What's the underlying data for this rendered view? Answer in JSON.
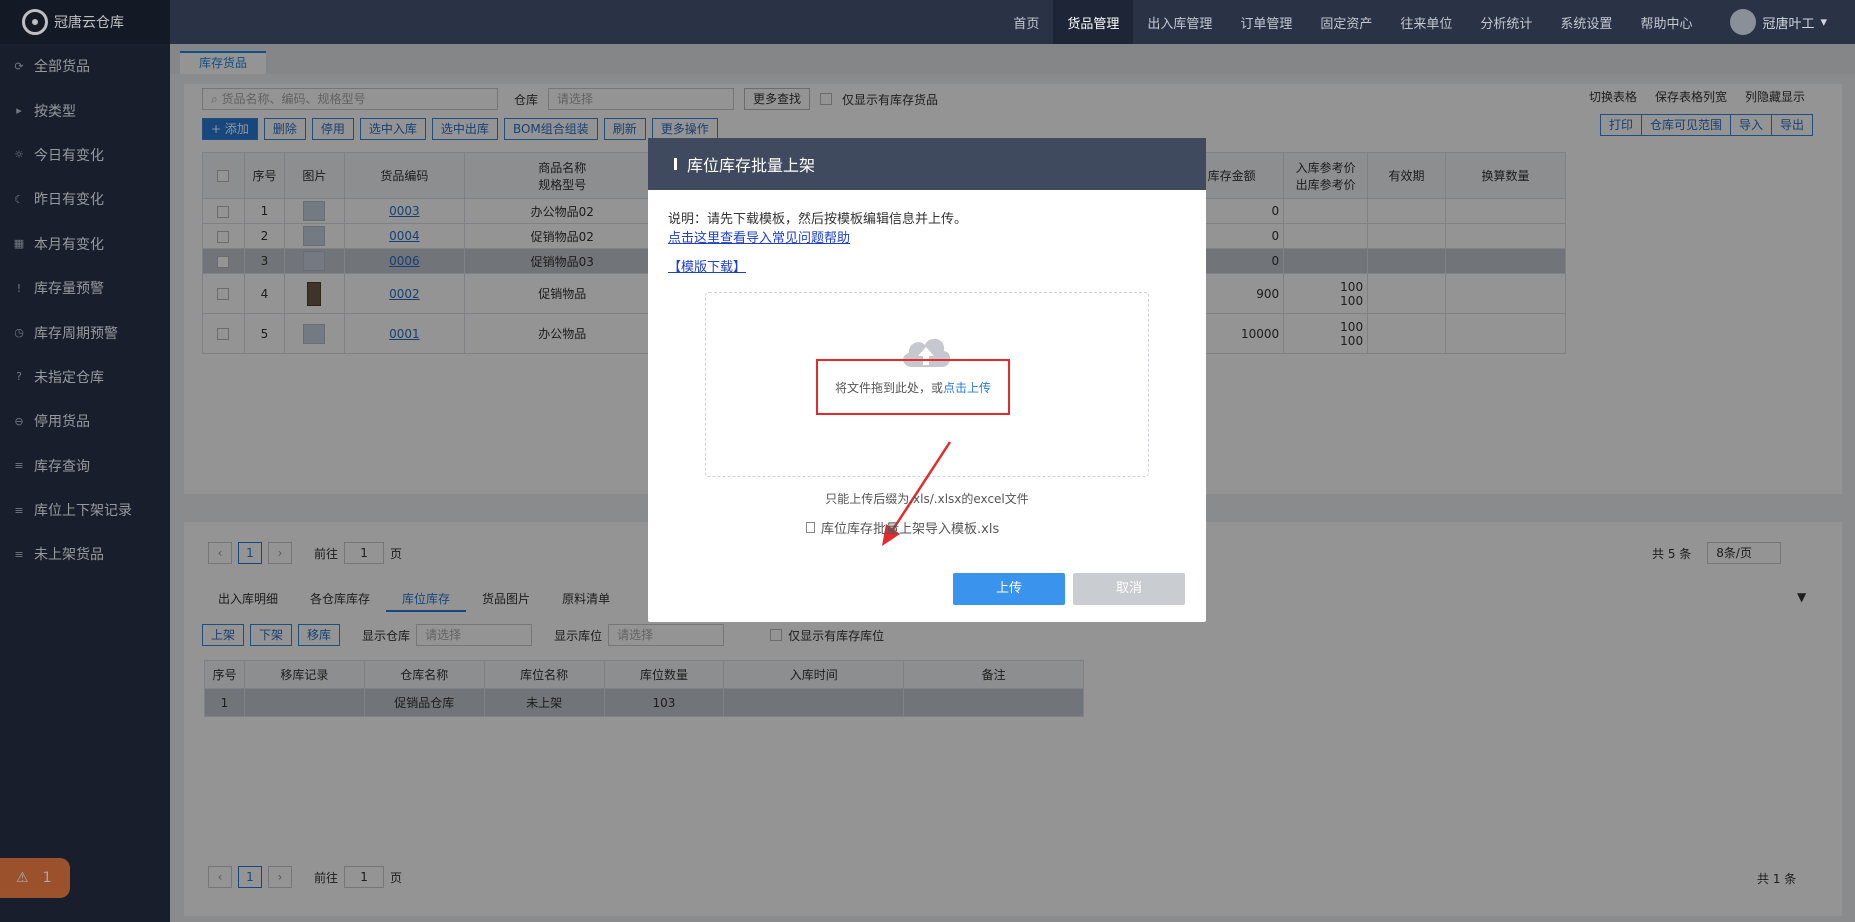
{
  "app": {
    "title": "冠唐云仓库"
  },
  "sidebar": {
    "items": [
      {
        "label": "全部货品",
        "icon": "refresh-icon"
      },
      {
        "label": "按类型",
        "icon": "caret-right-icon"
      },
      {
        "label": "今日有变化",
        "icon": "sun-icon"
      },
      {
        "label": "昨日有变化",
        "icon": "moon-icon"
      },
      {
        "label": "本月有变化",
        "icon": "calendar-icon"
      },
      {
        "label": "库存量预警",
        "icon": "alert-icon"
      },
      {
        "label": "库存周期预警",
        "icon": "clock-icon"
      },
      {
        "label": "未指定仓库",
        "icon": "question-icon"
      },
      {
        "label": "停用货品",
        "icon": "minus-circle-icon"
      },
      {
        "label": "库存查询",
        "icon": "list-icon"
      },
      {
        "label": "库位上下架记录",
        "icon": "list-icon"
      },
      {
        "label": "未上架货品",
        "icon": "list-icon"
      }
    ],
    "alarm_count": "1"
  },
  "topnav": {
    "items": [
      "首页",
      "货品管理",
      "出入库管理",
      "订单管理",
      "固定资产",
      "往来单位",
      "分析统计",
      "系统设置",
      "帮助中心"
    ],
    "active": "货品管理",
    "user": "冠唐叶工"
  },
  "page_tab": "库存货品",
  "search": {
    "placeholder": "货品名称、编码、规格型号",
    "warehouse_label": "仓库",
    "warehouse_placeholder": "请选择",
    "more_search": "更多查找",
    "only_stock": "仅显示有库存货品"
  },
  "toolbar": {
    "add": "+ 添加",
    "delete": "删除",
    "disable": "停用",
    "in": "选中入库",
    "out": "选中出库",
    "bom": "BOM组合组装",
    "refresh": "刷新",
    "more": "更多操作"
  },
  "right_tools": {
    "switch": "切换表格",
    "save_width": "保存表格列宽",
    "hide_cols": "列隐藏显示",
    "print": "打印",
    "visible": "仓库可见范围",
    "import": "导入",
    "export": "导出"
  },
  "table": {
    "headers": [
      "序号",
      "图片",
      "货品编码",
      "商品名称",
      "规格型号",
      "库存金额",
      "入库参考价",
      "出库参考价",
      "有效期",
      "换算数量"
    ],
    "rows": [
      {
        "no": "1",
        "code": "0003",
        "name": "办公物品02",
        "amount": "0",
        "inp": "",
        "outp": ""
      },
      {
        "no": "2",
        "code": "0004",
        "name": "促销物品02",
        "amount": "0",
        "inp": "",
        "outp": ""
      },
      {
        "no": "3",
        "code": "0006",
        "name": "促销物品03",
        "amount": "0",
        "inp": "",
        "outp": ""
      },
      {
        "no": "4",
        "code": "0002",
        "name": "促销物品",
        "amount": "900",
        "inp": "100",
        "outp": "100"
      },
      {
        "no": "5",
        "code": "0001",
        "name": "办公物品",
        "amount": "10000",
        "inp": "100",
        "outp": "100"
      }
    ]
  },
  "pager": {
    "current": "1",
    "goto": "前往",
    "page_unit": "页",
    "total": "共 5 条",
    "per_page": "8条/页"
  },
  "subtabs": [
    "出入库明细",
    "各仓库库存",
    "库位库存",
    "货品图片",
    "原料清单"
  ],
  "subtab_active": "库位库存",
  "sub_toolbar": {
    "up": "上架",
    "down": "下架",
    "move": "移库",
    "show_wh": "显示仓库",
    "show_loc": "显示库位",
    "placeholder": "请选择",
    "only_loc": "仅显示有库存库位"
  },
  "sub_table": {
    "headers": [
      "序号",
      "移库记录",
      "仓库名称",
      "库位名称",
      "库位数量",
      "入库时间",
      "备注"
    ],
    "rows": [
      {
        "no": "1",
        "record": "",
        "wh": "促销品仓库",
        "loc": "未上架",
        "qty": "103",
        "time": "",
        "note": ""
      }
    ]
  },
  "sub_pager": {
    "current": "1",
    "goto": "前往",
    "page_unit": "页",
    "total": "共 1 条"
  },
  "modal": {
    "title": "库位库存批量上架",
    "desc": "说明：请先下载模板，然后按模板编辑信息并上传。",
    "help_link": "点击这里查看导入常见问题帮助",
    "download": "【模版下载】",
    "drop_text": "将文件拖到此处，或",
    "click_upload": "点击上传",
    "note": "只能上传后缀为.xls/.xlsx的excel文件",
    "file": "库位库存批量上架导入模板.xls",
    "upload": "上传",
    "cancel": "取消"
  }
}
